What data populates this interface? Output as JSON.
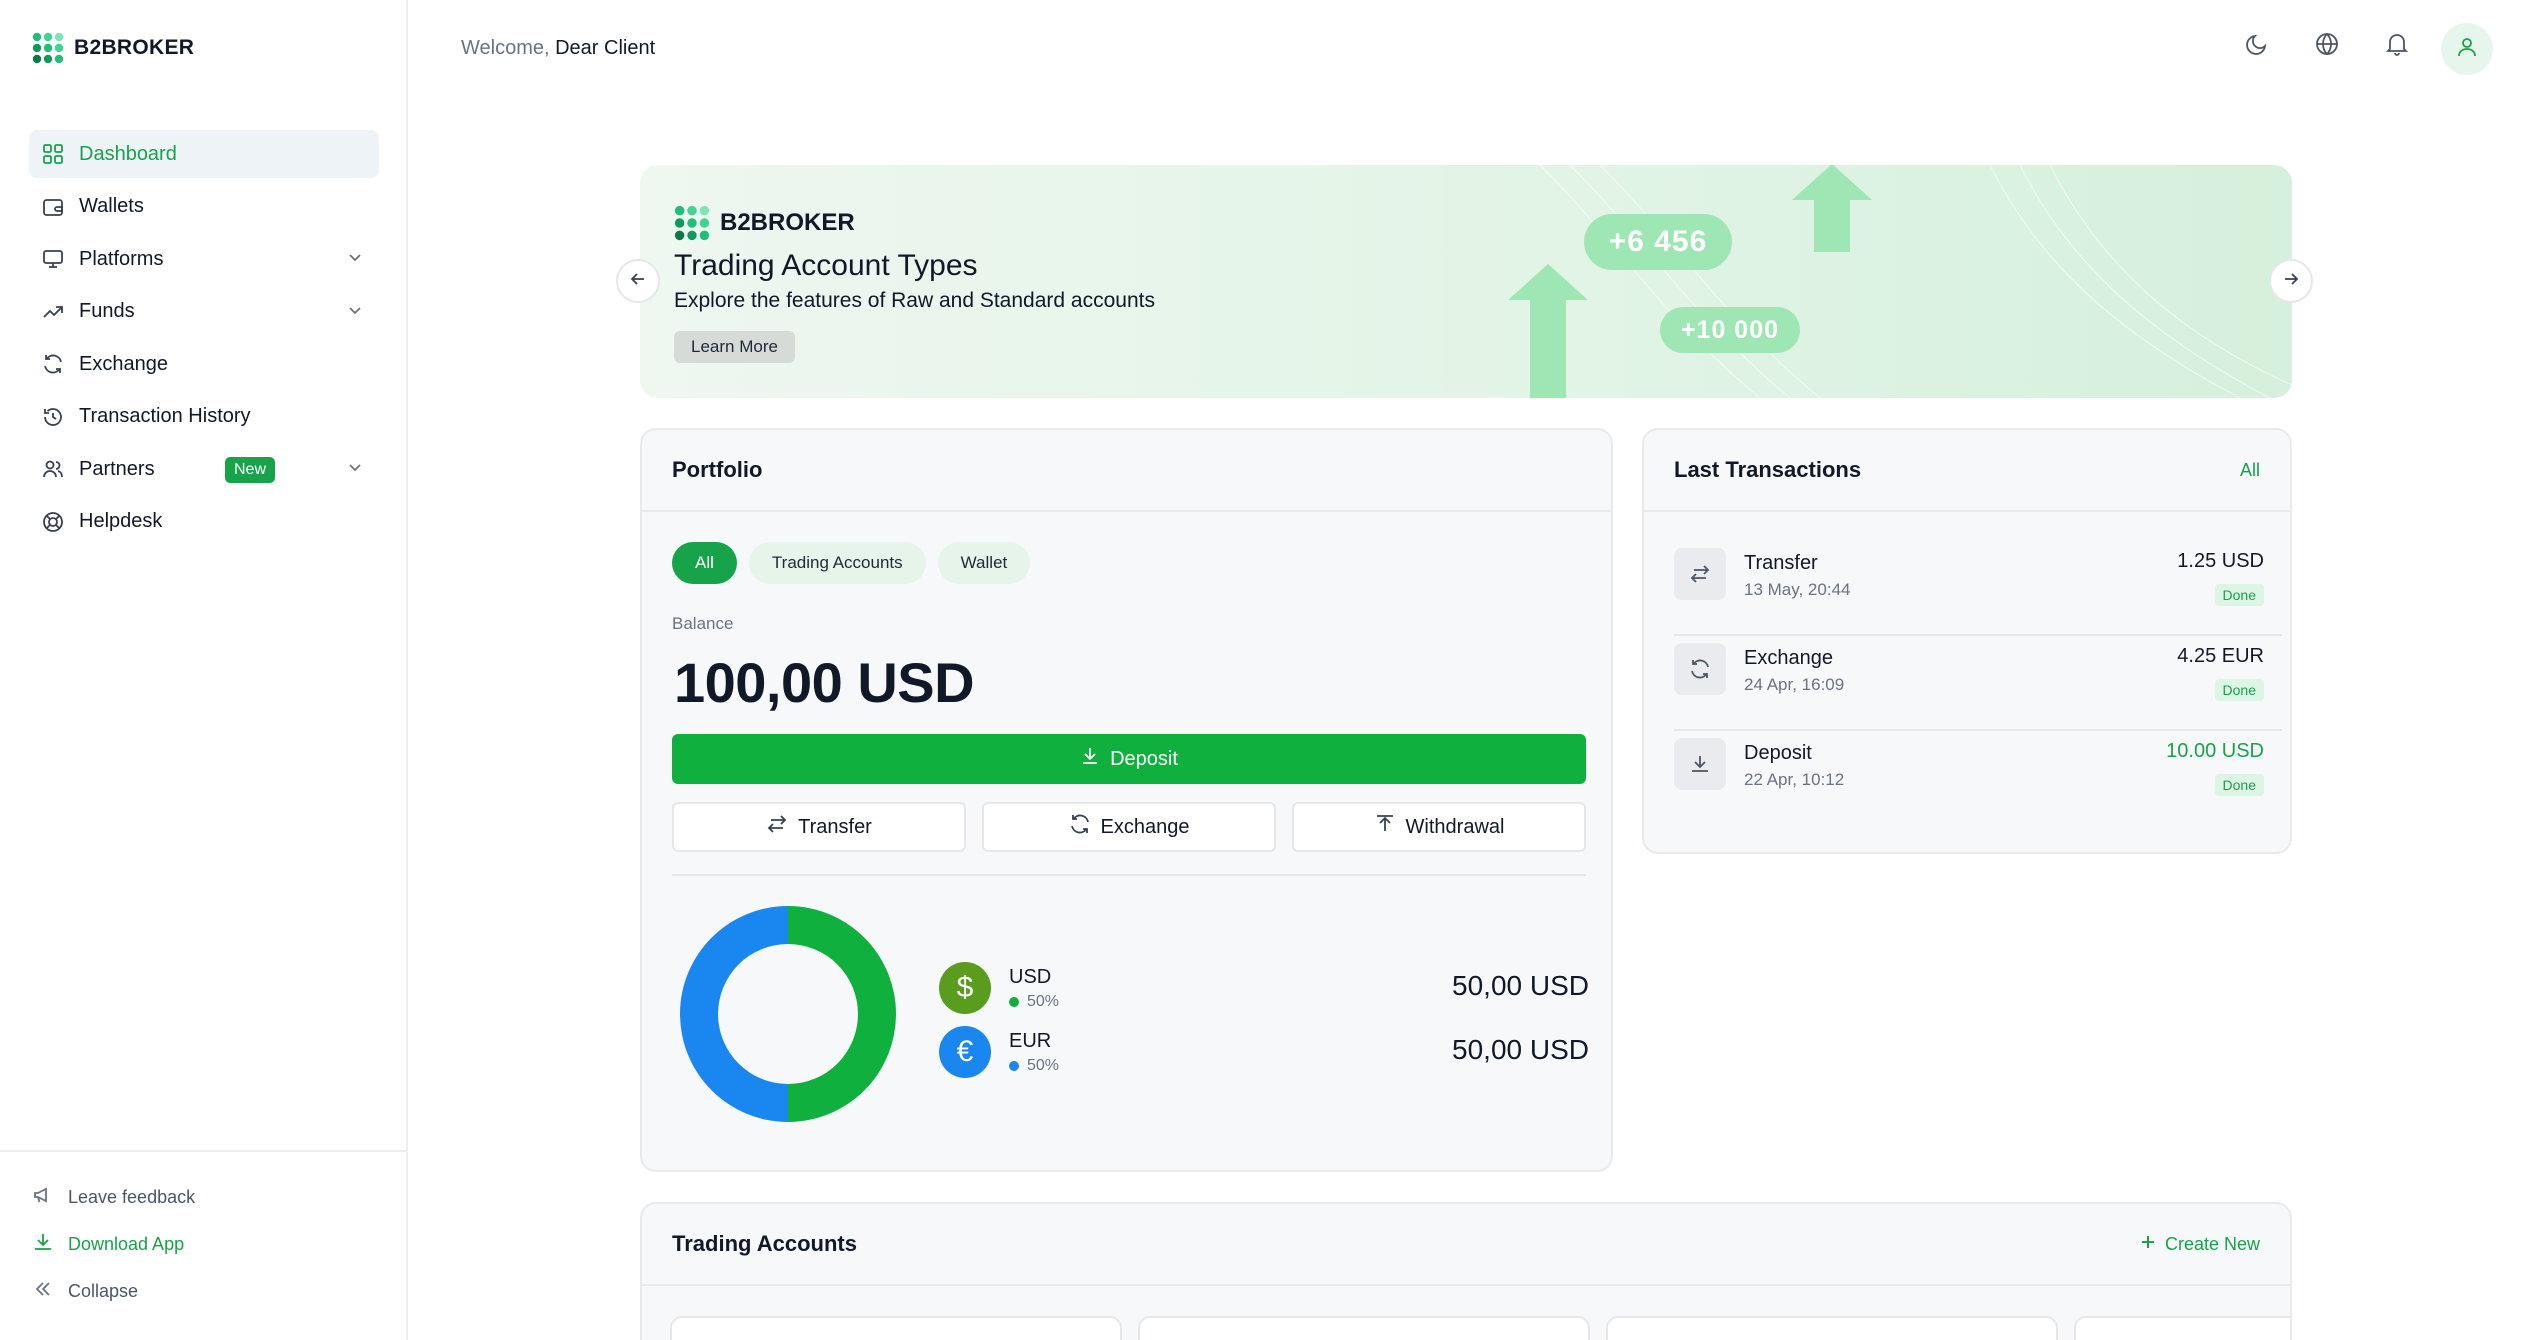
{
  "brand": {
    "name": "B2BROKER"
  },
  "header": {
    "welcome_prefix": "Welcome,",
    "welcome_name": "Dear Client"
  },
  "sidebar": {
    "items": [
      {
        "label": "Dashboard",
        "icon": "grid-icon",
        "active": true
      },
      {
        "label": "Wallets",
        "icon": "wallet-icon"
      },
      {
        "label": "Platforms",
        "icon": "monitor-icon",
        "expandable": true
      },
      {
        "label": "Funds",
        "icon": "trend-up-icon",
        "expandable": true
      },
      {
        "label": "Exchange",
        "icon": "refresh-icon"
      },
      {
        "label": "Transaction History",
        "icon": "history-icon"
      },
      {
        "label": "Partners",
        "icon": "users-icon",
        "expandable": true,
        "badge": "New"
      },
      {
        "label": "Helpdesk",
        "icon": "lifebuoy-icon"
      }
    ],
    "bottom": {
      "feedback": "Leave feedback",
      "download": "Download App",
      "collapse": "Collapse"
    }
  },
  "banner": {
    "brand": "B2BROKER",
    "title": "Trading Account Types",
    "subtitle": "Explore the features of Raw and Standard accounts",
    "button": "Learn More",
    "pill_1": "+6 456",
    "pill_2": "+10 000"
  },
  "portfolio": {
    "title": "Portfolio",
    "tabs": [
      "All",
      "Trading Accounts",
      "Wallet"
    ],
    "balance_label": "Balance",
    "balance_value": "100,00 USD",
    "deposit": "Deposit",
    "transfer": "Transfer",
    "exchange": "Exchange",
    "withdrawal": "Withdrawal",
    "currencies": [
      {
        "name": "USD",
        "pct": "50%",
        "share": 0.5,
        "amount": "50,00 USD",
        "color": "#10b03e",
        "icon_color": "#5a9d1e"
      },
      {
        "name": "EUR",
        "pct": "50%",
        "share": 0.5,
        "amount": "50,00 USD",
        "color": "#1a87f0",
        "icon_color": "#1a87f0"
      }
    ]
  },
  "transactions": {
    "title": "Last Transactions",
    "link": "All",
    "items": [
      {
        "name": "Transfer",
        "date": "13 May, 20:44",
        "amount": "1.25 USD",
        "status": "Done"
      },
      {
        "name": "Exchange",
        "date": "24 Apr, 16:09",
        "amount": "4.25 EUR",
        "status": "Done"
      },
      {
        "name": "Deposit",
        "date": "22 Apr, 10:12",
        "amount": "10.00 USD",
        "status": "Done"
      }
    ]
  },
  "trading_accounts": {
    "title": "Trading Accounts",
    "link": "Create New"
  },
  "colors": {
    "accent": "#16a34a",
    "eur": "#1a87f0"
  }
}
